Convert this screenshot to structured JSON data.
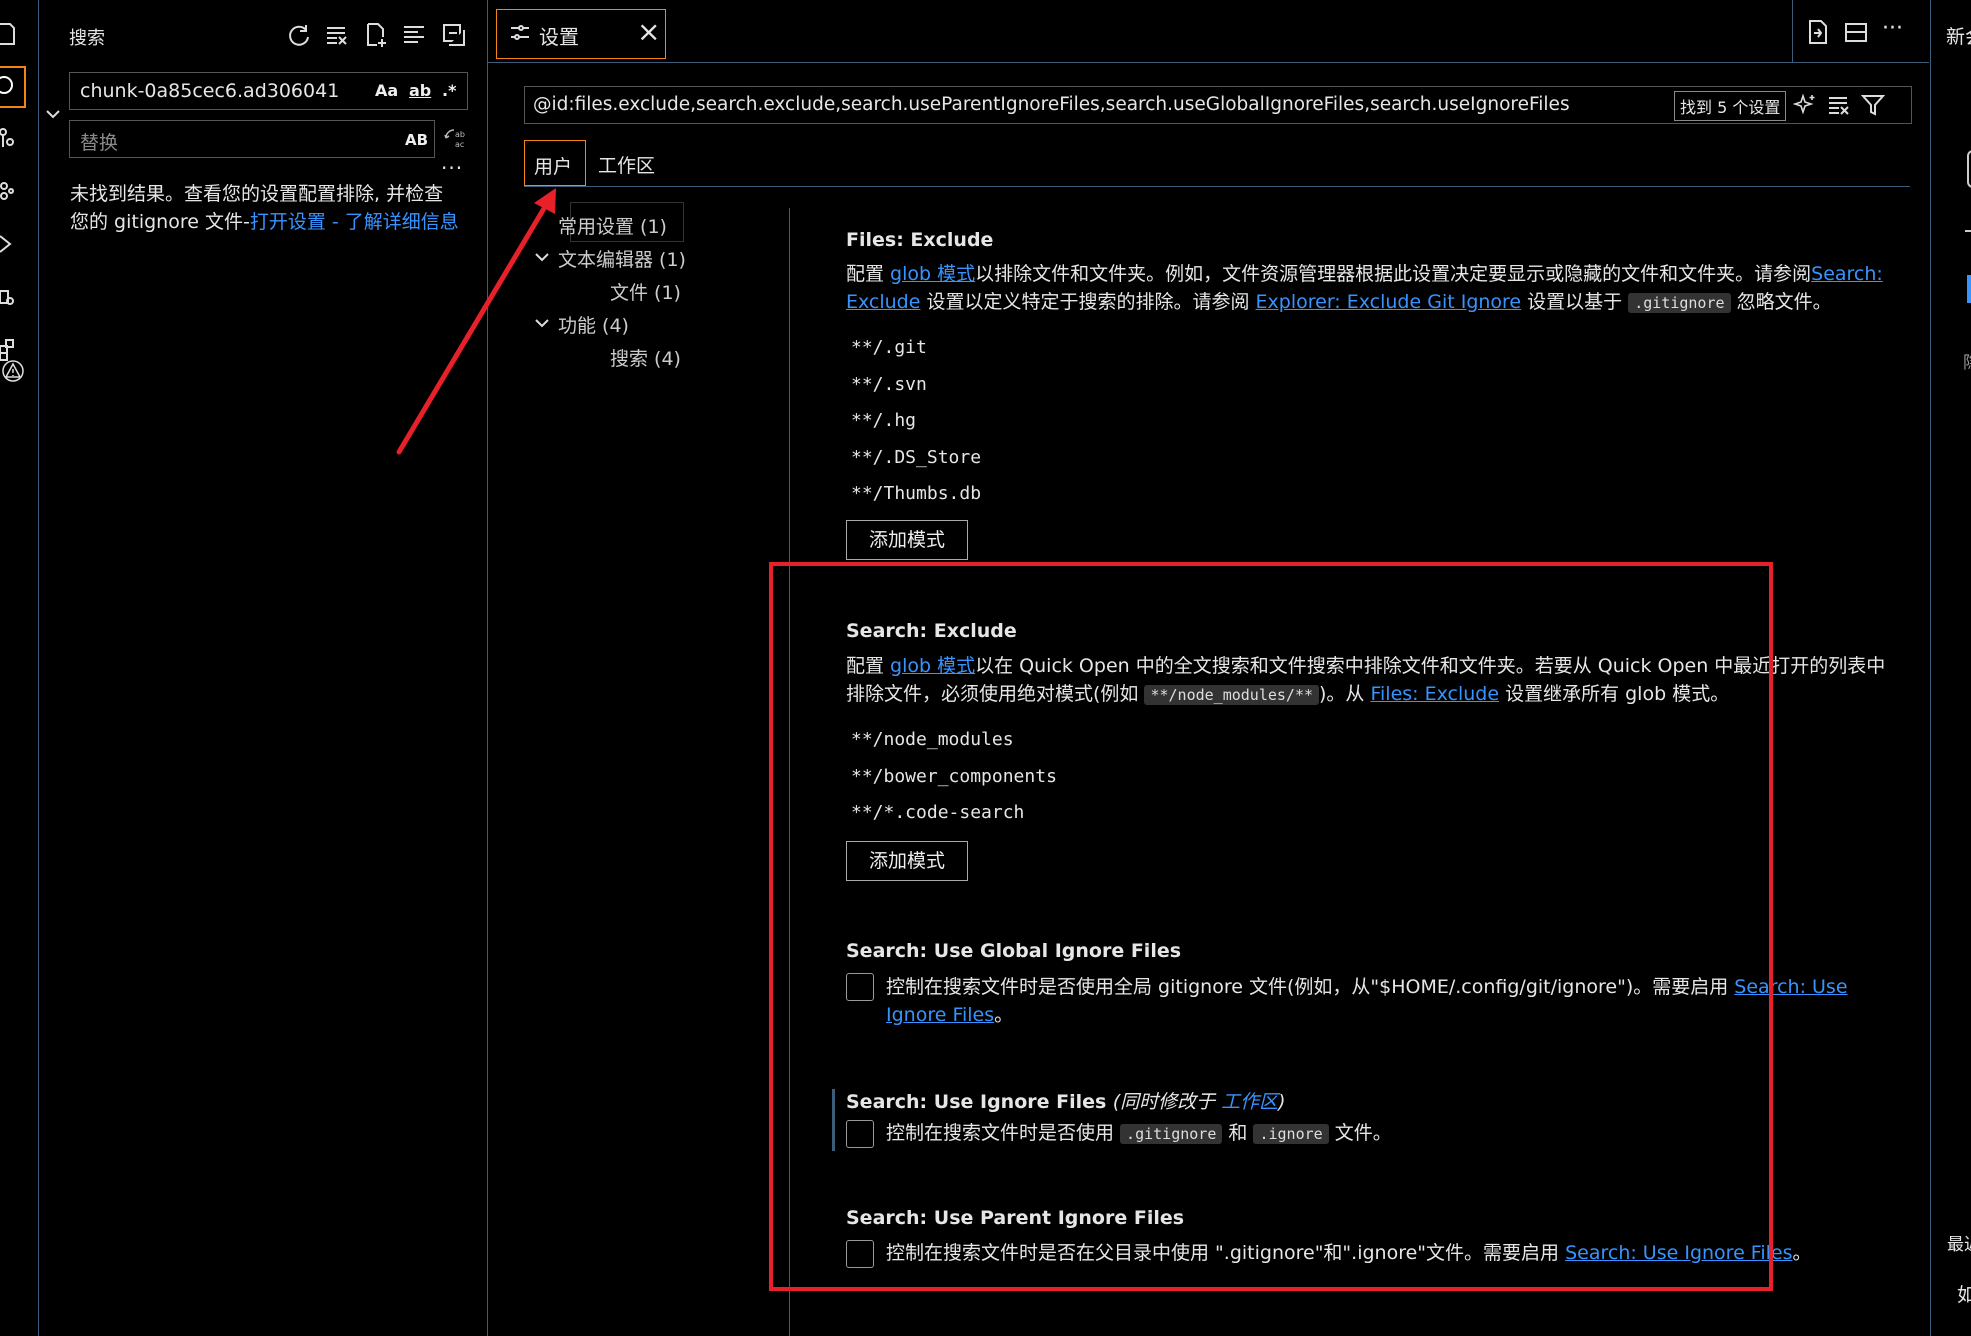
{
  "search_panel": {
    "title": "搜索",
    "search_value": "chunk-0a85cec6.ad306041",
    "opt_case": "Aa",
    "opt_word": "ab",
    "opt_regex": ".*",
    "replace_placeholder": "替换",
    "replace_opt": "AB",
    "more": "...",
    "no_results_text": "未找到结果。查看您的设置配置排除, 并检查您的 gitignore 文件-",
    "open_settings_link": "打开设置",
    "separator": " - ",
    "learn_more_link": "了解详细信息"
  },
  "editor": {
    "tab_title": "设置",
    "tab_close": "×",
    "more_actions": "···",
    "settings_query": "@id:files.exclude,search.exclude,search.useParentIgnoreFiles,search.useGlobalIgnoreFiles,search.useIgnoreFiles",
    "found_count": "找到 5 个设置",
    "scope_tabs": [
      "用户",
      "工作区"
    ],
    "toc": [
      {
        "label": "常用设置 (1)",
        "indent": 0,
        "chevron": false
      },
      {
        "label": "文本编辑器 (1)",
        "indent": 0,
        "chevron": true
      },
      {
        "label": "文件 (1)",
        "indent": 1,
        "chevron": false
      },
      {
        "label": "功能 (4)",
        "indent": 0,
        "chevron": true
      },
      {
        "label": "搜索 (4)",
        "indent": 1,
        "chevron": false
      }
    ],
    "settings": {
      "files_exclude": {
        "title": "Files: Exclude",
        "desc_p1": "配置 ",
        "desc_link1": "glob 模式",
        "desc_p2": "以排除文件和文件夹。例如，文件资源管理器根据此设置决定要显示或隐藏的文件和文件夹。请参阅",
        "desc_link2": "Search: Exclude",
        "desc_p3": " 设置以定义特定于搜索的排除。请参阅 ",
        "desc_link3": "Explorer: Exclude Git Ignore",
        "desc_p4": " 设置以基于 ",
        "desc_code": ".gitignore",
        "desc_p5": " 忽略文件。",
        "patterns": [
          "**/.git",
          "**/.svn",
          "**/.hg",
          "**/.DS_Store",
          "**/Thumbs.db"
        ],
        "add_button": "添加模式"
      },
      "search_exclude": {
        "title": "Search: Exclude",
        "desc_p1": "配置 ",
        "desc_link1": "glob 模式",
        "desc_p2": "以在 Quick Open 中的全文搜索和文件搜索中排除文件和文件夹。若要从 Quick Open 中最近打开的列表中排除文件，必须使用绝对模式(例如 ",
        "desc_code": "**/node_modules/**",
        "desc_p3": ")。从 ",
        "desc_link2": "Files: Exclude",
        "desc_p4": " 设置继承所有 glob 模式。",
        "patterns": [
          "**/node_modules",
          "**/bower_components",
          "**/*.code-search"
        ],
        "add_button": "添加模式"
      },
      "use_global_ignore": {
        "title": "Search: Use Global Ignore Files",
        "desc_p1": "控制在搜索文件时是否使用全局 gitignore 文件(例如，从\"$HOME/.config/git/ignore\")。需要启用 ",
        "desc_link": "Search: Use Ignore Files",
        "desc_p2": "。"
      },
      "use_ignore": {
        "title": "Search: Use Ignore Files",
        "modified_prefix": "(同时修改于 ",
        "modified_link": "工作区",
        "modified_suffix": ")",
        "desc_p1": "控制在搜索文件时是否使用 ",
        "desc_code1": ".gitignore",
        "desc_p2": " 和 ",
        "desc_code2": ".ignore",
        "desc_p3": " 文件。"
      },
      "use_parent_ignore": {
        "title": "Search: Use Parent Ignore Files",
        "desc_p1": "控制在搜索文件时是否在父目录中使用 \".gitignore\"和\".ignore\"文件。需要启用 ",
        "desc_link": "Search: Use Ignore Files",
        "desc_p2": "。"
      }
    }
  },
  "right_panel": {
    "top_text": "新会",
    "mid_text": "隐",
    "bottom_text1": "最近",
    "bottom_text2": "如"
  },
  "colors": {
    "accent_border": "#f38518",
    "link": "#3794ff",
    "annotation": "#e8202a",
    "panel_border": "#3b5d7a"
  }
}
